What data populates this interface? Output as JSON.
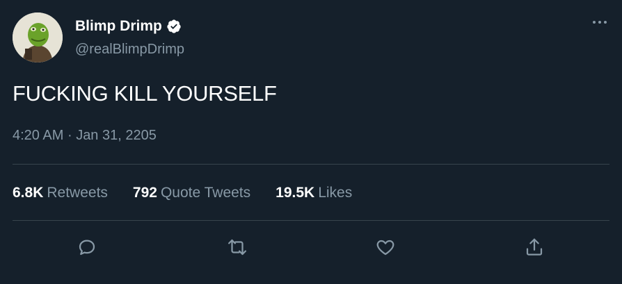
{
  "author": {
    "display_name": "Blimp Drimp",
    "handle": "@realBlimpDrimp",
    "verified": true,
    "verified_icon": "verified-badge-icon",
    "avatar_alt": "avatar"
  },
  "tweet": {
    "text": "FUCKING KILL YOURSELF",
    "time": "4:20 AM",
    "separator": "·",
    "date": "Jan 31, 2205"
  },
  "stats": {
    "retweets_count": "6.8K",
    "retweets_label": "Retweets",
    "quotes_count": "792",
    "quotes_label": "Quote Tweets",
    "likes_count": "19.5K",
    "likes_label": "Likes"
  },
  "actions": {
    "reply_icon": "reply-icon",
    "retweet_icon": "retweet-icon",
    "like_icon": "heart-icon",
    "share_icon": "share-icon",
    "more_icon": "more-icon"
  },
  "colors": {
    "background": "#15202b",
    "primary_text": "#ffffff",
    "secondary_text": "#8899a6",
    "divider": "#38444d"
  }
}
